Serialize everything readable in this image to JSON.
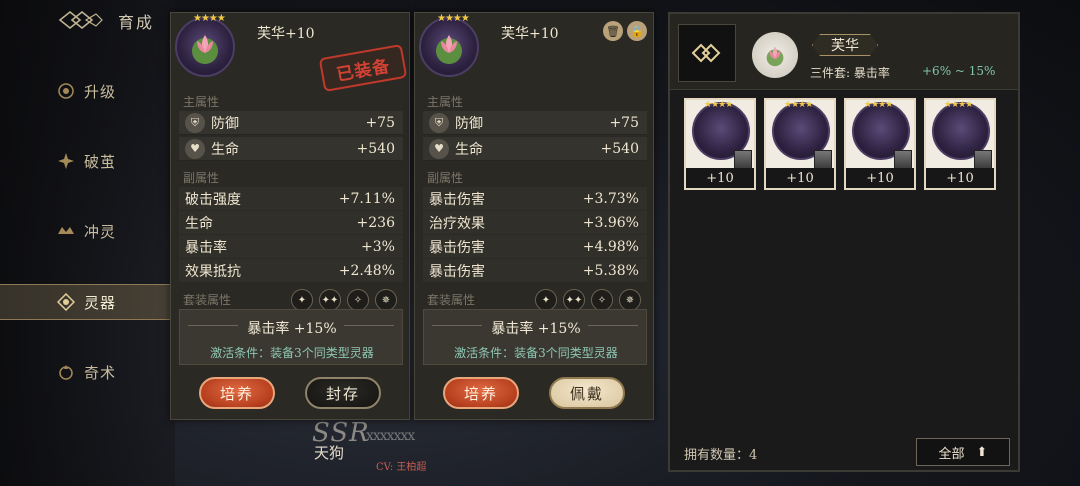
{
  "nav": {
    "title": "育成",
    "items": [
      {
        "label": "升级",
        "icon": "upgrade-icon"
      },
      {
        "label": "破茧",
        "icon": "breakthrough-icon"
      },
      {
        "label": "冲灵",
        "icon": "spirit-icon"
      },
      {
        "label": "灵器",
        "icon": "artifact-icon",
        "active": true
      },
      {
        "label": "奇术",
        "icon": "arcane-icon"
      }
    ]
  },
  "character": {
    "rarity": "SSR",
    "rarity_suffix": "xxxxxxx",
    "name": "天狗",
    "cv": "CV: 王柏超"
  },
  "cards": [
    {
      "name": "芙华+10",
      "stars": "★★★★",
      "equipped_label": "已装备",
      "main_label": "主属性",
      "main_stats": [
        {
          "name": "防御",
          "value": "+75",
          "icon": "shield-icon"
        },
        {
          "name": "生命",
          "value": "+540",
          "icon": "heart-icon"
        }
      ],
      "sub_label": "副属性",
      "sub_stats": [
        {
          "name": "破击强度",
          "value": "+7.11%"
        },
        {
          "name": "生命",
          "value": "+236"
        },
        {
          "name": "暴击率",
          "value": "+3%"
        },
        {
          "name": "效果抵抗",
          "value": "+2.48%"
        }
      ],
      "set_label": "套装属性",
      "set_bonus": "暴击率 +15%",
      "set_condition": "激活条件：装备3个同类型灵器",
      "btn_left": "培养",
      "btn_right": "封存"
    },
    {
      "name": "芙华+10",
      "stars": "★★★★",
      "main_label": "主属性",
      "main_stats": [
        {
          "name": "防御",
          "value": "+75",
          "icon": "shield-icon"
        },
        {
          "name": "生命",
          "value": "+540",
          "icon": "heart-icon"
        }
      ],
      "sub_label": "副属性",
      "sub_stats": [
        {
          "name": "暴击伤害",
          "value": "+3.73%"
        },
        {
          "name": "治疗效果",
          "value": "+3.96%"
        },
        {
          "name": "暴击伤害",
          "value": "+4.98%"
        },
        {
          "name": "暴击伤害",
          "value": "+5.38%"
        }
      ],
      "set_label": "套装属性",
      "set_bonus": "暴击率 +15%",
      "set_condition": "激活条件：装备3个同类型灵器",
      "btn_left": "培养",
      "btn_right": "佩戴"
    }
  ],
  "inventory": {
    "set_name": "芙华",
    "set_desc": "三件套: 暴击率",
    "set_range": "+6% ~ 15%",
    "items": [
      {
        "level": "+10",
        "stars": "★★★★"
      },
      {
        "level": "+10",
        "stars": "★★★★"
      },
      {
        "level": "+10",
        "stars": "★★★★"
      },
      {
        "level": "+10",
        "stars": "★★★★"
      }
    ],
    "count_label": "拥有数量：4",
    "filter_label": "全部"
  }
}
